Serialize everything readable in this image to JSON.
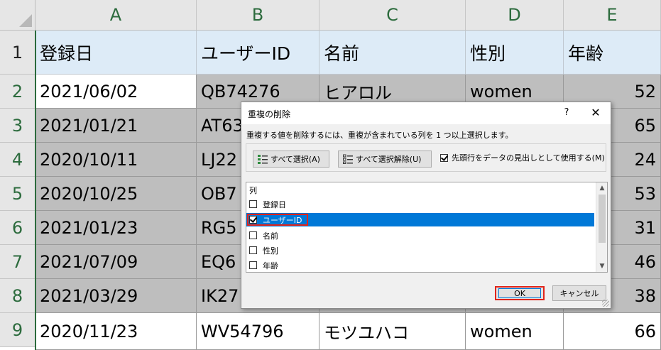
{
  "columns": [
    "A",
    "B",
    "C",
    "D",
    "E"
  ],
  "rows": [
    "1",
    "2",
    "3",
    "4",
    "5",
    "6",
    "7",
    "8",
    "9"
  ],
  "header_row": [
    "登録日",
    "ユーザーID",
    "名前",
    "性別",
    "年齢"
  ],
  "data": [
    [
      "2021/06/02",
      "QB74276",
      "ヒアロル",
      "women",
      "52"
    ],
    [
      "2021/01/21",
      "AT63",
      "",
      "",
      "65"
    ],
    [
      "2020/10/11",
      "LJ22",
      "",
      "",
      "24"
    ],
    [
      "2020/10/25",
      "OB7",
      "",
      "",
      "53"
    ],
    [
      "2021/01/23",
      "RG5",
      "",
      "",
      "31"
    ],
    [
      "2021/07/09",
      "EQ6",
      "",
      "",
      "46"
    ],
    [
      "2021/03/29",
      "IK27",
      "",
      "",
      "38"
    ],
    [
      "2020/11/23",
      "WV54796",
      "モツユハコ",
      "women",
      "66"
    ]
  ],
  "dialog": {
    "title": "重複の削除",
    "help": "?",
    "close": "✕",
    "instruction": "重複する値を削除するには、重複が含まれている列を 1 つ以上選択します。",
    "select_all": "すべて選択(A)",
    "unselect_all": "すべて選択解除(U)",
    "header_option": "先頭行をデータの見出しとして使用する(M)",
    "header_option_checked": true,
    "list_header": "列",
    "items": [
      {
        "label": "登録日",
        "checked": false
      },
      {
        "label": "ユーザーID",
        "checked": true
      },
      {
        "label": "名前",
        "checked": false
      },
      {
        "label": "性別",
        "checked": false
      },
      {
        "label": "年齢",
        "checked": false
      }
    ],
    "ok": "OK",
    "cancel": "キャンセル"
  },
  "colors": {
    "header_fill": "#ddebf7",
    "dimmed_fill": "#bebebe",
    "selection": "#0078d7",
    "highlight_box": "#e0241b",
    "row_col_header_text": "#2c6b3d"
  }
}
